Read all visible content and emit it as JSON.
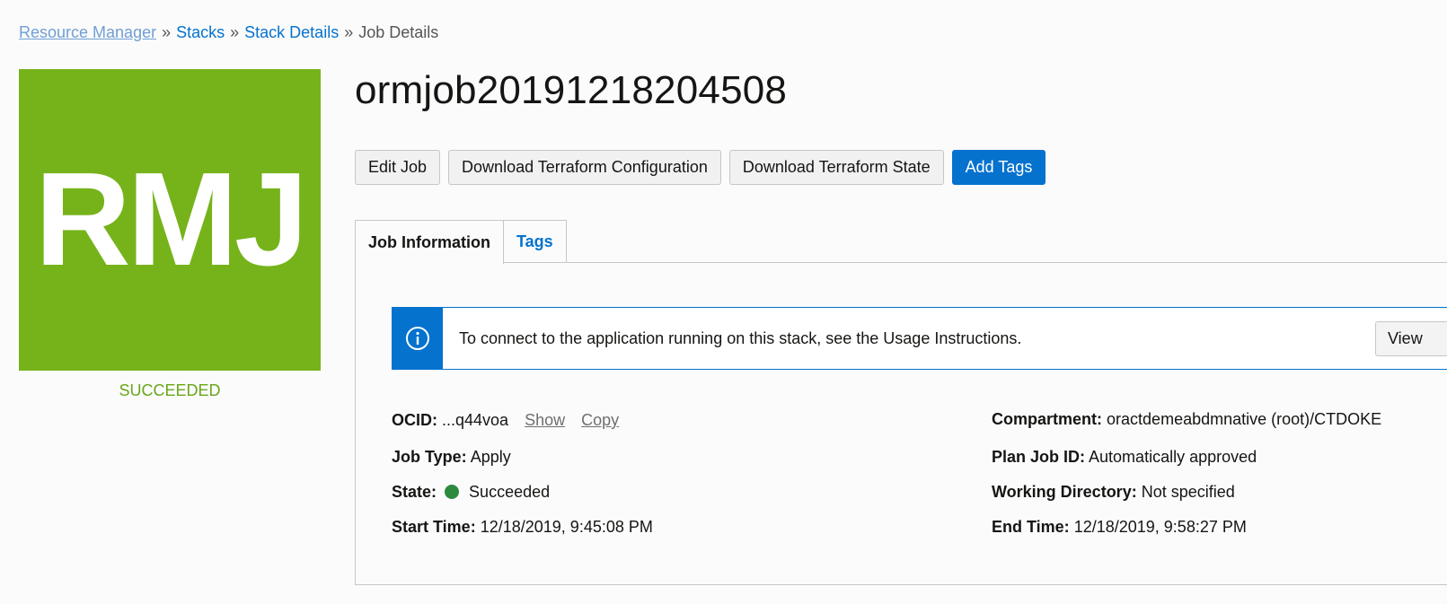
{
  "breadcrumb": {
    "items": [
      "Resource Manager",
      "Stacks",
      "Stack Details"
    ],
    "current": "Job Details",
    "separator": "»"
  },
  "badge": {
    "initials": "RMJ",
    "status": "SUCCEEDED",
    "color": "#76b31b"
  },
  "title": "ormjob20191218204508",
  "actions": {
    "edit_job": "Edit Job",
    "download_config": "Download Terraform Configuration",
    "download_state": "Download Terraform State",
    "add_tags": "Add Tags"
  },
  "tabs": {
    "job_information": "Job Information",
    "tags": "Tags"
  },
  "banner": {
    "icon": "info-icon",
    "message": "To connect to the application running on this stack, see the Usage Instructions.",
    "button": "View"
  },
  "details": {
    "ocid": {
      "label": "OCID:",
      "value": "...q44voa",
      "show": "Show",
      "copy": "Copy"
    },
    "job_type": {
      "label": "Job Type:",
      "value": "Apply"
    },
    "state": {
      "label": "State:",
      "value": "Succeeded",
      "color": "#2b8a3e"
    },
    "start_time": {
      "label": "Start Time:",
      "value": "12/18/2019, 9:45:08 PM"
    },
    "compartment": {
      "label": "Compartment:",
      "value": "oractdemeabdmnative (root)/CTDOKE"
    },
    "plan_job_id": {
      "label": "Plan Job ID:",
      "value": "Automatically approved"
    },
    "working_directory": {
      "label": "Working Directory:",
      "value": "Not specified"
    },
    "end_time": {
      "label": "End Time:",
      "value": "12/18/2019, 9:58:27 PM"
    }
  },
  "colors": {
    "accent": "#0572ce",
    "success": "#76b31b"
  }
}
